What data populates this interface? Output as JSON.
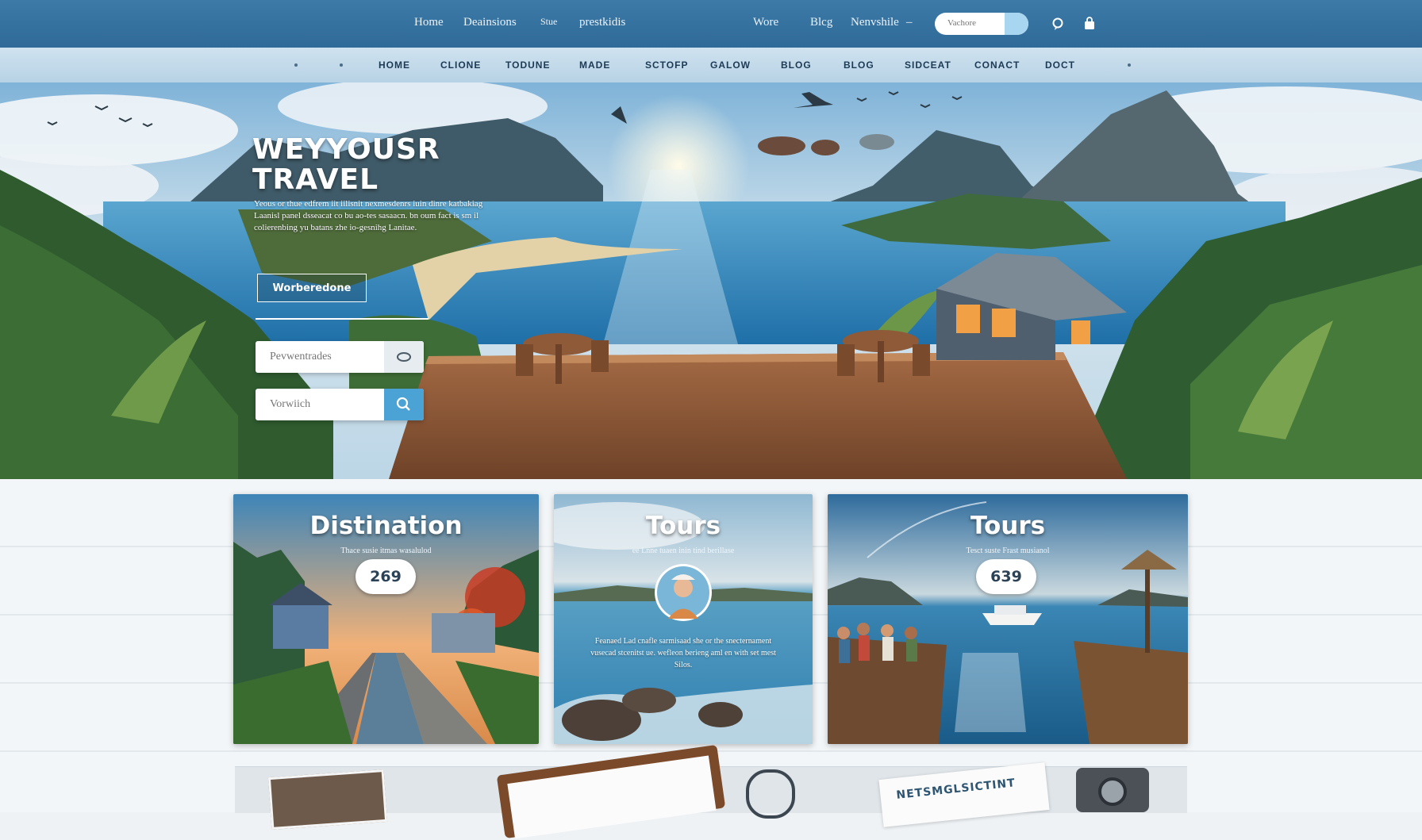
{
  "topbar": {
    "links": [
      "Home",
      "Deainsions",
      "Stue",
      "prestkidis"
    ],
    "right_links": [
      "Wore",
      "Blcg",
      "Nenvshile"
    ],
    "dropdown_arrow": "–",
    "search_placeholder": "Vachore",
    "icons": [
      "chat-icon",
      "bag-icon"
    ]
  },
  "nav": {
    "items": [
      "HOME",
      "CLIONE",
      "TODUNE",
      "MADE",
      "SCTOFP",
      "GALOW",
      "BLOG",
      "BLOG",
      "SIDCEAT",
      "CONACT",
      "DOCT"
    ]
  },
  "hero": {
    "title_line1": "WEYYOUSR",
    "title_line2": "TRAVEL",
    "subtitle": "Yeous or thue edfrem iit iilisnit nexmesdenrs iuin dinre katbakiag Laanisl panel dsseacat co bu ao-tes sasaacn. bn oum fact is sm il colierenbing yu batans zhe io-gesnihg Lanitae.",
    "button_label": "Worberedone",
    "input1_placeholder": "Pevwentrades",
    "input2_placeholder": "Vorwiich"
  },
  "cards": [
    {
      "title": "Distination",
      "caption": "Thace susie itmas wasalulod",
      "count": "269",
      "desc": ""
    },
    {
      "title": "Tours",
      "caption": "ee Lnne tuaen inin tind berillase",
      "count": "",
      "desc": "Feanaed Lad cnafle sarmisaad she or the snecternament vusecad stcenitst ue. wefleon berieng aml en with set mest Silos."
    },
    {
      "title": "Tours",
      "caption": "Tesct suste Frast musianol",
      "count": "639",
      "desc": ""
    }
  ],
  "footer_note": "NETSMGLSICTINT",
  "colors": {
    "topbar": "#2f6a98",
    "nav_strip": "#c4dbea",
    "accent_blue": "#4aa3d4",
    "nav_text": "#1d3a55"
  }
}
